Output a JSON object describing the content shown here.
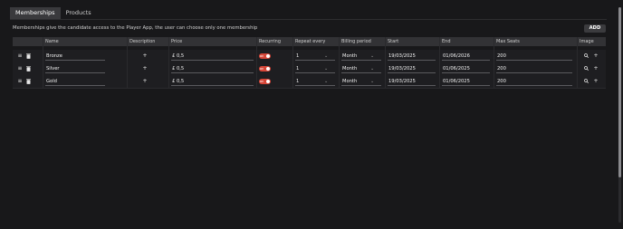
{
  "tabs": [
    {
      "label": "Memberships",
      "active": true
    },
    {
      "label": "Products",
      "active": false
    }
  ],
  "description": "Memberships give the candidate access to the Player App, the user can choose only one membership",
  "add_button": "ADD",
  "columns": [
    "Name",
    "Description",
    "Price",
    "Recurring",
    "Repeat every",
    "Billing period",
    "Start",
    "End",
    "Max Seats",
    "Image"
  ],
  "rows": [
    {
      "name": "Bronze",
      "price": "£ 0,5",
      "recurring": "on",
      "repeat": "1",
      "period": "Month",
      "start": "19/03/2025",
      "end": "01/06/2026",
      "seats": "200"
    },
    {
      "name": "Silver",
      "price": "£ 0,5",
      "recurring": "on",
      "repeat": "1",
      "period": "Month",
      "start": "19/03/2025",
      "end": "01/06/2025",
      "seats": "200"
    },
    {
      "name": "Gold",
      "price": "£ 0,5",
      "recurring": "on",
      "repeat": "1",
      "period": "Month",
      "start": "19/03/2025",
      "end": "01/06/2025",
      "seats": "200"
    }
  ],
  "icons": {
    "drag": "drag-handle-icon",
    "delete": "trash-icon",
    "add_description": "plus-icon",
    "search_image": "search-icon",
    "add_image": "plus-icon",
    "dropdown": "chevron-down-icon"
  },
  "colors": {
    "accent": "#d64537",
    "background": "#18181a",
    "header": "#323235"
  }
}
